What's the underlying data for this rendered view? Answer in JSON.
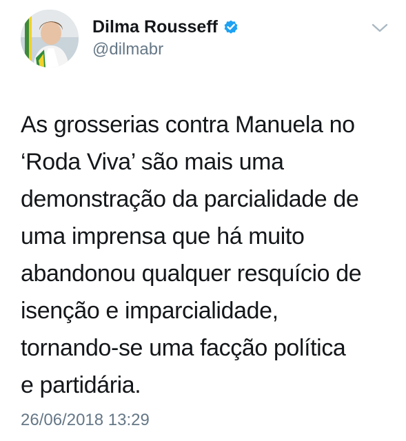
{
  "tweet": {
    "author": {
      "display_name": "Dilma Rousseff",
      "handle": "@dilmabr",
      "verified": true
    },
    "icons": {
      "verified": "verified-badge-icon",
      "menu": "chevron-down-icon"
    },
    "text_lines": [
      "As grosserias contra Manuela no",
      "‘Roda Viva’ são mais uma",
      "demonstração da parcialidade de",
      "uma imprensa que há muito",
      "abandonou qualquer resquício de",
      "isenção e imparcialidade,",
      "tornando-se uma facção política",
      "e partidária."
    ],
    "timestamp": "26/06/2018 13:29"
  },
  "colors": {
    "text": "#14171a",
    "secondary": "#657786",
    "verified_blue": "#1da1f2",
    "background": "#ffffff"
  }
}
